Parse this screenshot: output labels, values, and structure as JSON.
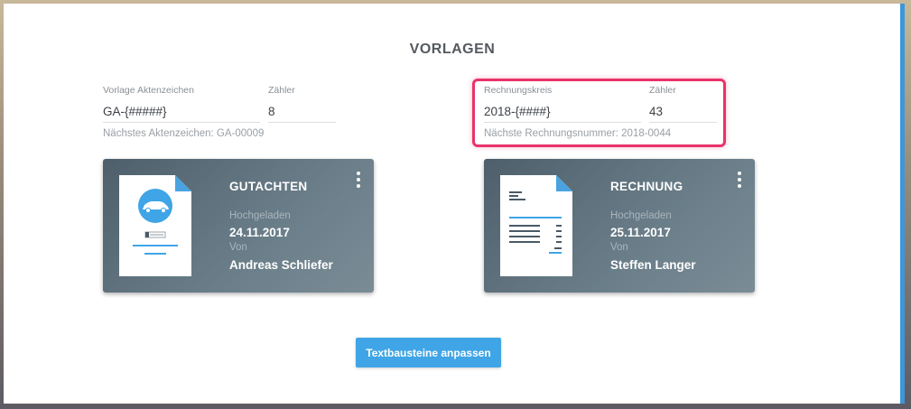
{
  "page": {
    "title": "VORLAGEN"
  },
  "aktenzeichen": {
    "label": "Vorlage Aktenzeichen",
    "value": "GA-{#####}",
    "counter_label": "Zähler",
    "counter_value": "8",
    "hint": "Nächstes Aktenzeichen: GA-00009"
  },
  "rechnungskreis": {
    "label": "Rechnungskreis",
    "value": "2018-{####}",
    "counter_label": "Zähler",
    "counter_value": "43",
    "hint": "Nächste Rechnungsnummer: 2018-0044"
  },
  "cards": [
    {
      "title": "GUTACHTEN",
      "uploaded_label": "Hochgeladen",
      "uploaded_date": "24.11.2017",
      "by_label": "Von",
      "by_name": "Andreas Schliefer",
      "icon": "car-report-document-icon"
    },
    {
      "title": "RECHNUNG",
      "uploaded_label": "Hochgeladen",
      "uploaded_date": "25.11.2017",
      "by_label": "Von",
      "by_name": "Steffen Langer",
      "icon": "invoice-document-icon"
    }
  ],
  "actions": {
    "textbausteine_label": "Textbausteine anpassen"
  },
  "colors": {
    "accent": "#3fa5e6",
    "highlight": "#e8336a",
    "card": "#5c6f7b"
  }
}
